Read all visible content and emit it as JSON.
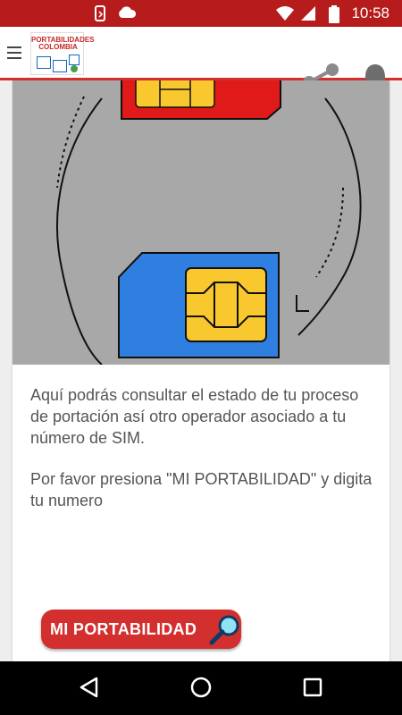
{
  "status_bar": {
    "time": "10:58"
  },
  "app_bar": {
    "logo_line1": "PORTABILIDADES",
    "logo_line2": "COLOMBIA"
  },
  "content": {
    "paragraph1": "Aquí podrás consultar el estado de tu proceso de portación así otro operador asociado a tu número de SIM.",
    "paragraph2": "Por favor presiona \"MI PORTABILIDAD\" y digita tu numero"
  },
  "cta": {
    "label": "MI PORTABILIDAD"
  },
  "colors": {
    "primary": "#d32f2f",
    "sim_red": "#e01919",
    "sim_blue": "#2f7fe0",
    "chip": "#f9c72e"
  }
}
